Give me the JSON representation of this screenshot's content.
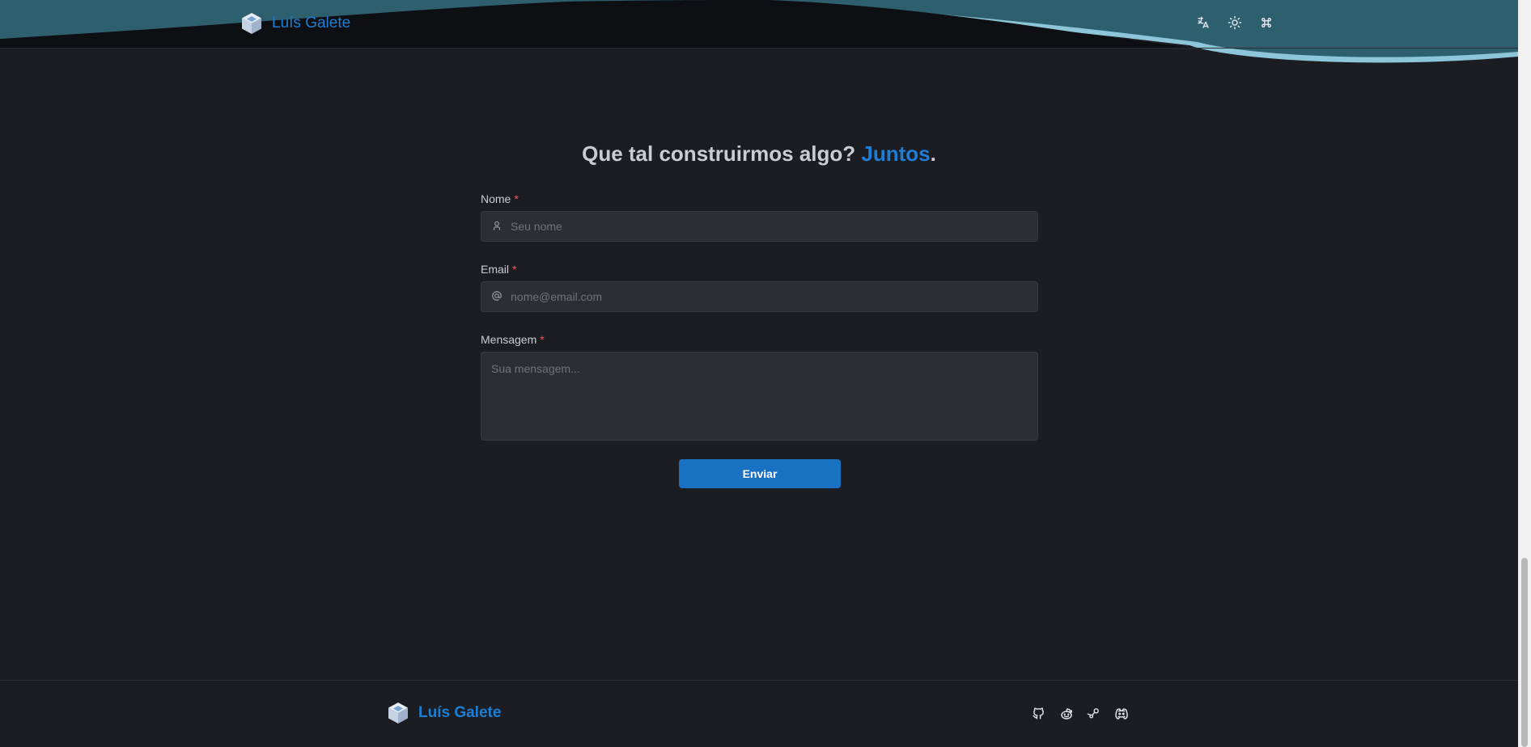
{
  "header": {
    "brand_name": "Luís Galete",
    "icons": [
      "translate-icon",
      "sun-icon",
      "command-icon"
    ]
  },
  "main": {
    "title_prefix": "Que tal construirmos algo?",
    "title_accent": "Juntos",
    "title_suffix": ".",
    "form": {
      "name_label": "Nome",
      "name_placeholder": "Seu nome",
      "email_label": "Email",
      "email_placeholder": "nome@email.com",
      "message_label": "Mensagem",
      "message_placeholder": "Sua mensagem...",
      "required_mark": "*",
      "submit_label": "Enviar"
    }
  },
  "footer": {
    "brand_name": "Luís Galete",
    "social_icons": [
      "github-icon",
      "reddit-icon",
      "steam-icon",
      "discord-icon"
    ]
  },
  "colors": {
    "background": "#1b1d22",
    "accent": "#1c7ed6",
    "button": "#1971c2",
    "required": "#fa5252",
    "input_bg": "#2c2e33"
  }
}
